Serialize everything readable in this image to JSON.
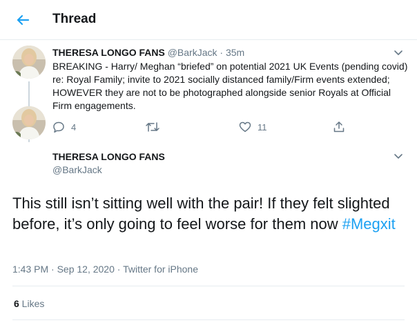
{
  "header": {
    "title": "Thread"
  },
  "tweet1": {
    "name": "THERESA LONGO FANS",
    "handle": "@BarkJack",
    "separator": "·",
    "time": "35m",
    "text": "BREAKING - Harry/ Meghan “briefed” on potential 2021 UK Events (pending covid) re: Royal Family; invite  to 2021 socially distanced family/Firm events extended; HOWEVER they are not to be photographed alongside senior Royals at Official Firm engagements.",
    "replies": "4",
    "retweets": "",
    "likes": "11"
  },
  "tweet2": {
    "name": "THERESA LONGO FANS",
    "handle": "@BarkJack",
    "text": "This still isn’t sitting well with the pair! If they felt slighted before, it’s only going to feel worse for them now ",
    "hashtag": "#Megxit",
    "timestamp": "1:43 PM · Sep 12, 2020 · Twitter for iPhone",
    "likes_count": "6",
    "likes_label": " Likes"
  },
  "colors": {
    "accent": "#1da1f2",
    "text": "#14171a",
    "muted": "#657786",
    "border": "#e6ecf0"
  },
  "icons": [
    "back-arrow-icon",
    "chevron-down-icon",
    "reply-icon",
    "retweet-icon",
    "like-icon",
    "share-icon"
  ]
}
